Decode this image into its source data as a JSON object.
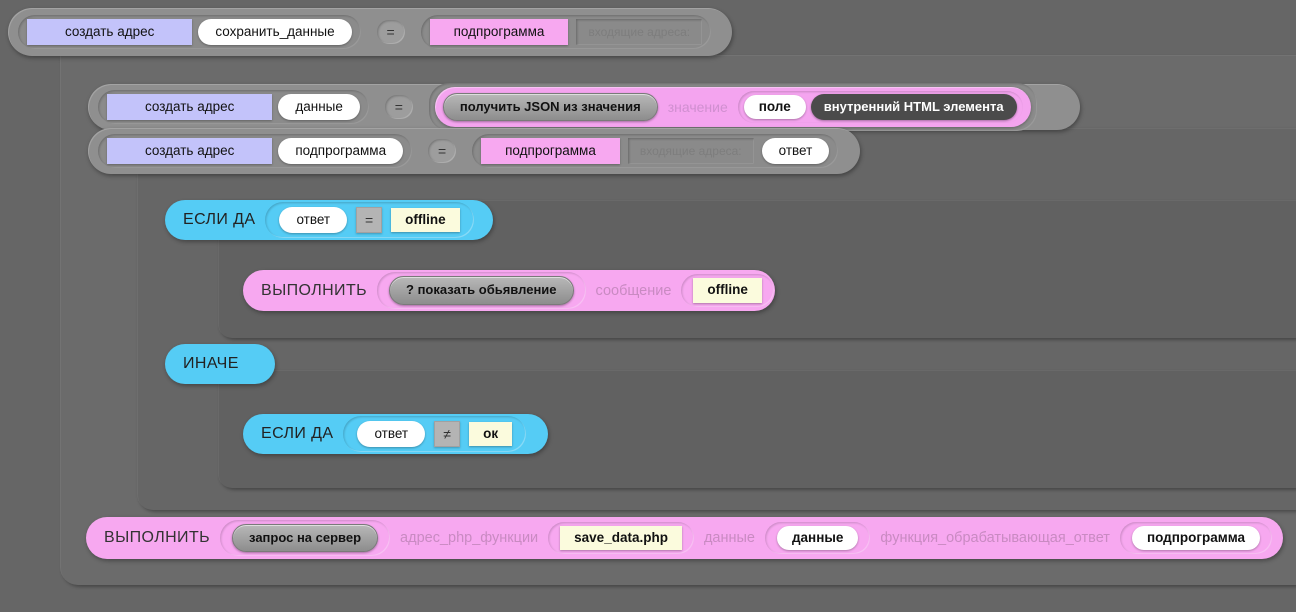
{
  "canvas": {
    "background_color": "#666666",
    "panel_color": "#6b6b6b",
    "accent_blue": "#55ccf5",
    "accent_magenta": "#f7a8f0",
    "accent_lavender": "#c3c3fa",
    "field_yellow": "#fbfbdd"
  },
  "rows": {
    "define_save_data": {
      "create_label": "создать адрес",
      "name_value": "сохранить_данные",
      "operator": "=",
      "type_label": "подпрограмма",
      "args_placeholder": "входящие адреса:"
    },
    "define_data": {
      "create_label": "создать адрес",
      "name_value": "данные",
      "operator": "=",
      "fn_label": "получить JSON из значения",
      "arg_label": "значение",
      "field_label": "поле",
      "field_value": "внутренний HTML элемента"
    },
    "define_subprogram": {
      "create_label": "создать адрес",
      "name_value": "подпрограмма",
      "operator": "=",
      "type_label": "подпрограмма",
      "args_placeholder": "входящие адреса:",
      "arg_value": "ответ"
    }
  },
  "if_offline": {
    "keyword": "ЕСЛИ ДА",
    "left_value": "ответ",
    "operator": "=",
    "right_value": "offline"
  },
  "do_show_message": {
    "keyword": "ВЫПОЛНИТЬ",
    "action": "? показать обьявление",
    "param_label": "сообщение",
    "param_value": "offline"
  },
  "else_block": {
    "keyword": "ИНАЧЕ"
  },
  "if_not_ok": {
    "keyword": "ЕСЛИ ДА",
    "left_value": "ответ",
    "operator": "≠",
    "right_value": "ок"
  },
  "do_server_request": {
    "keyword": "ВЫПОЛНИТЬ",
    "action": "запрос на сервер",
    "param1_label": "адрес_php_функции",
    "param1_value": "save_data.php",
    "param2_label": "данные",
    "param2_value": "данные",
    "param3_label": "функция_обрабатывающая_ответ",
    "param3_value": "подпрограмма"
  }
}
